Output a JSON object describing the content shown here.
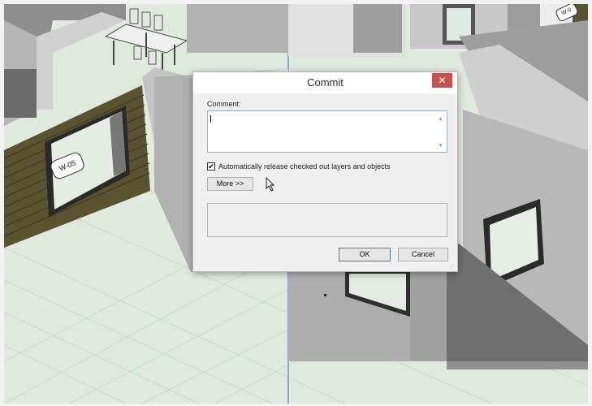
{
  "scene": {
    "tag_label": "W-05",
    "tag_corner": "W-0"
  },
  "dialog": {
    "title": "Commit",
    "close_glyph": "✕",
    "comment_label": "Comment:",
    "comment_value": "",
    "checkbox_checked_glyph": "✔",
    "checkbox_label": "Automatically release checked out layers and objects",
    "more_button": "More >>",
    "ok_button": "OK",
    "cancel_button": "Cancel"
  },
  "colors": {
    "close_button": "#c75050",
    "ok_border": "#3c7fb1",
    "floor": "#dfe9de",
    "siding": "#5a5330"
  },
  "icons": [
    "close-icon",
    "scroll-up-icon",
    "scroll-down-icon",
    "check-icon",
    "resize-grip-icon",
    "mouse-cursor-icon"
  ]
}
